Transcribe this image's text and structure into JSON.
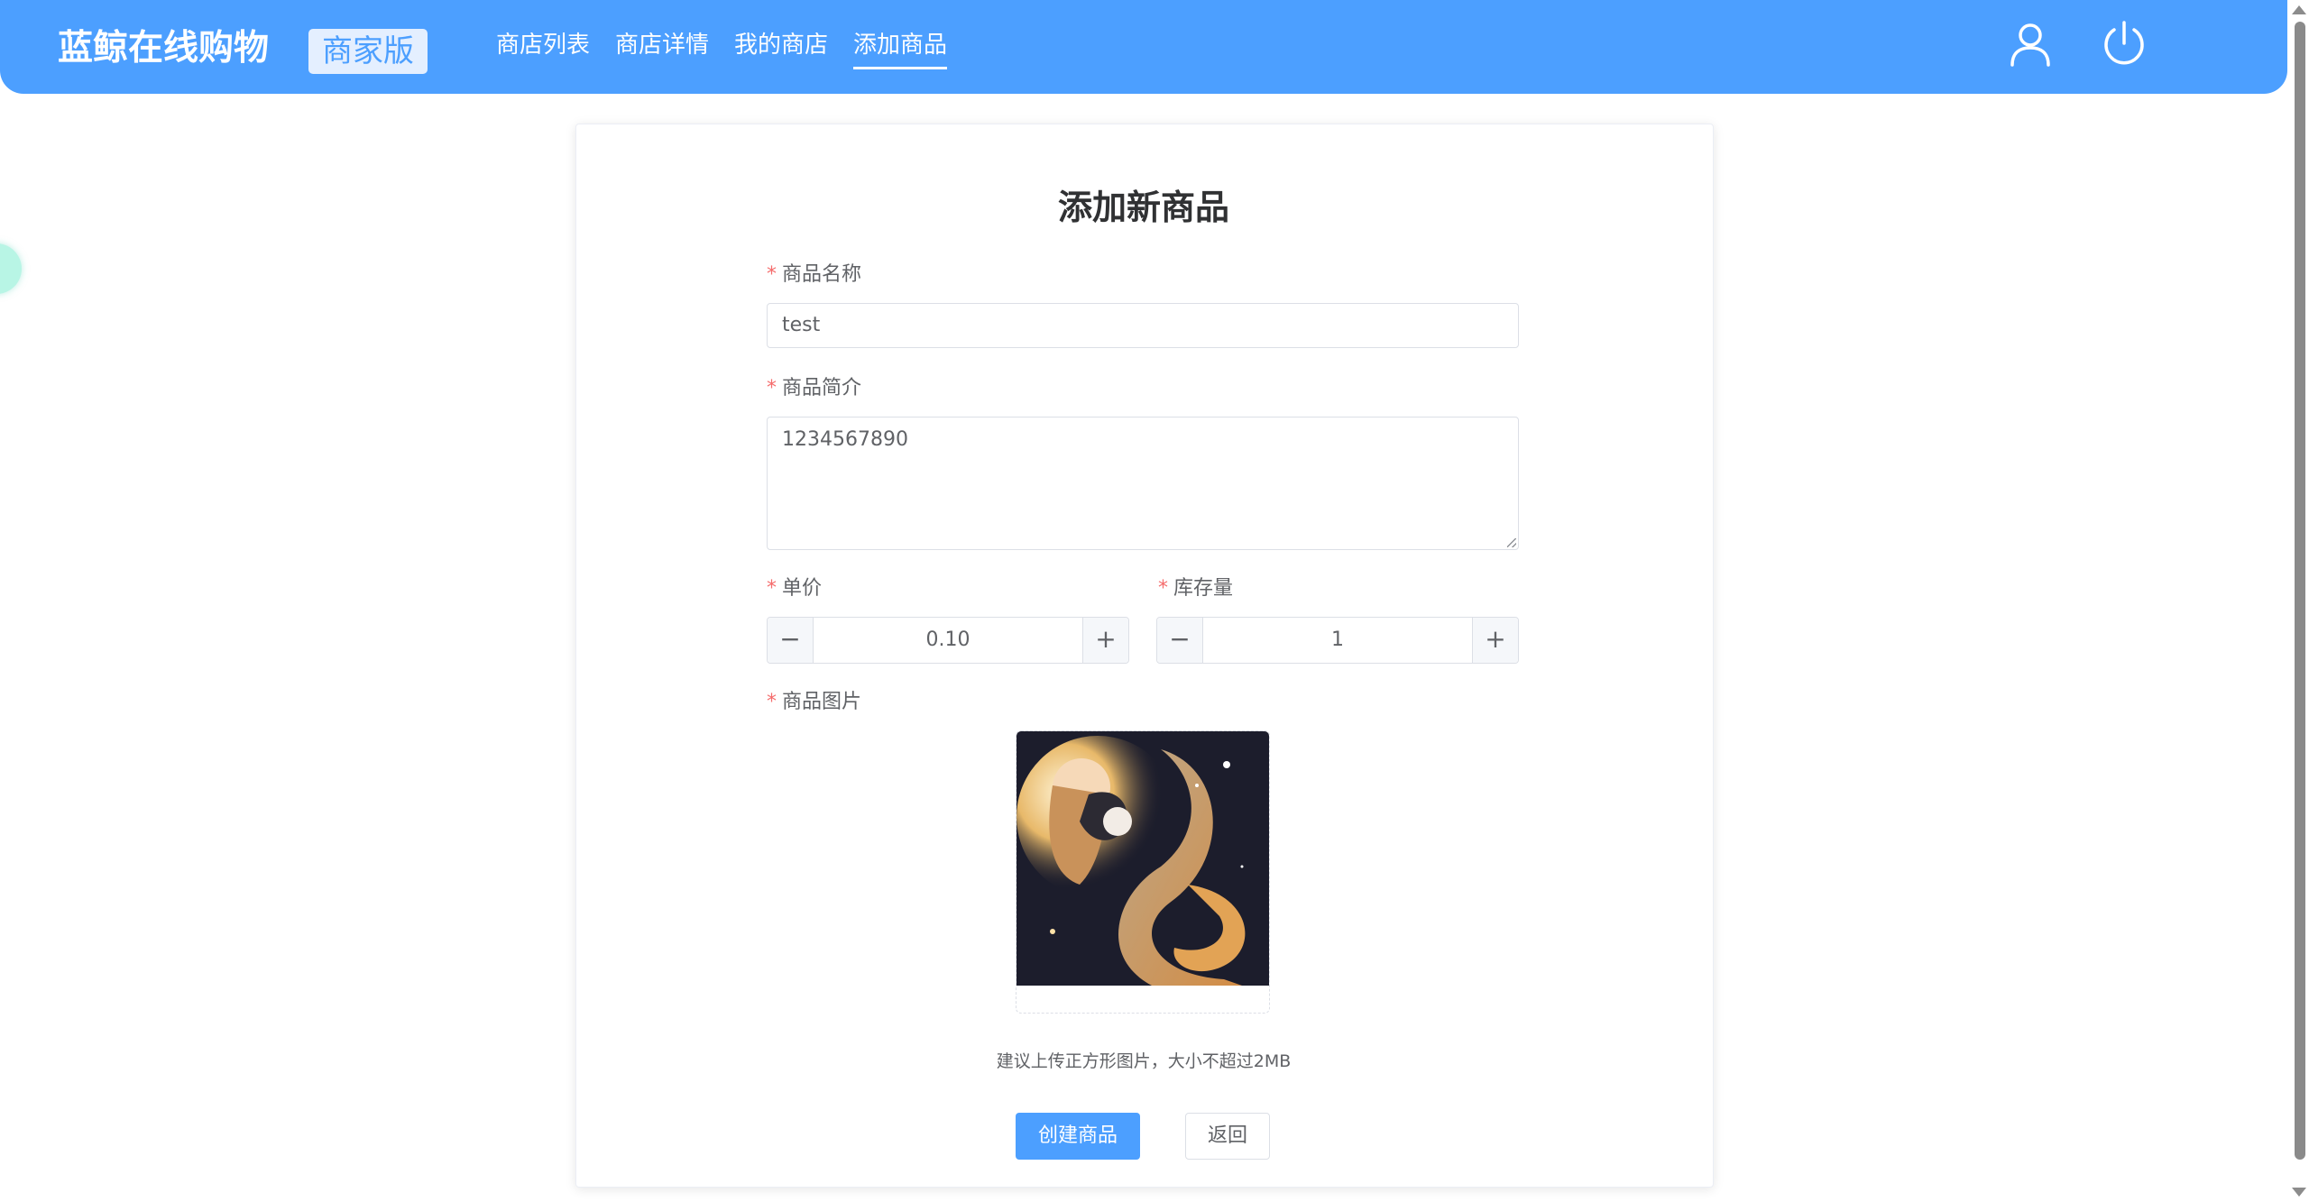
{
  "header": {
    "brand": "蓝鲸在线购物",
    "badge": "商家版",
    "nav": [
      {
        "label": "商店列表",
        "active": false
      },
      {
        "label": "商店详情",
        "active": false
      },
      {
        "label": "我的商店",
        "active": false
      },
      {
        "label": "添加商品",
        "active": true
      }
    ],
    "icons": [
      "user-icon",
      "power-icon"
    ]
  },
  "form": {
    "title": "添加新商品",
    "required_mark": "*",
    "name": {
      "label": "商品名称",
      "value": "test"
    },
    "description": {
      "label": "商品简介",
      "value": "1234567890"
    },
    "price": {
      "label": "单价",
      "value": "0.10",
      "minus": "−",
      "plus": "+"
    },
    "stock": {
      "label": "库存量",
      "value": "1",
      "minus": "−",
      "plus": "+"
    },
    "image": {
      "label": "商品图片",
      "hint": "建议上传正方形图片，大小不超过2MB"
    },
    "buttons": {
      "create": "创建商品",
      "back": "返回"
    }
  },
  "colors": {
    "primary": "#4c9fff",
    "required": "#f56c6c",
    "border": "#dcdfe6",
    "text": "#606266"
  }
}
